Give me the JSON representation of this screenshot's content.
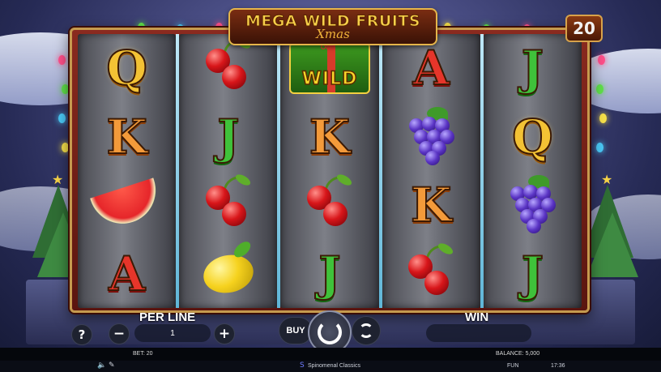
{
  "game": {
    "title": "MEGA WILD FRUITS",
    "subtitle": "Xmas",
    "lines": "20"
  },
  "reels": [
    [
      "Q",
      "K",
      "watermelon",
      "A"
    ],
    [
      "cherry",
      "J",
      "cherry",
      "lemon"
    ],
    [
      "WILD",
      "K",
      "cherry",
      "J"
    ],
    [
      "A",
      "grapes",
      "K",
      "cherry"
    ],
    [
      "J",
      "Q",
      "grapes",
      "J"
    ]
  ],
  "symbols": {
    "wild_label": "WILD"
  },
  "controls": {
    "per_line_label": "PER LINE",
    "per_line_value": "1",
    "win_label": "WIN",
    "help_label": "?",
    "minus_label": "−",
    "plus_label": "+",
    "buy_label": "BUY"
  },
  "status": {
    "bet": "BET: 20",
    "balance": "BALANCE: 5,000",
    "mode": "FUN",
    "time": "17:36",
    "provider": "Spinomenal Classics"
  },
  "colors": {
    "frame": "#8a2a1f",
    "gold": "#f3c234",
    "wild_green": "#3d9a1f"
  }
}
